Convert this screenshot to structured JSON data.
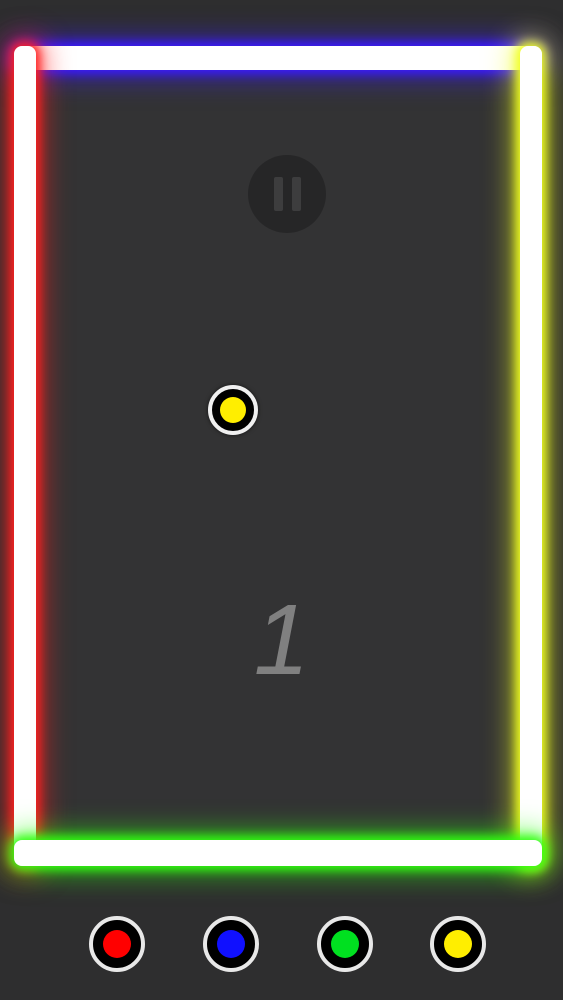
{
  "game": {
    "score": "1",
    "ball_color": "#ffee00"
  },
  "walls": {
    "top": {
      "color": "#3a1aff"
    },
    "left": {
      "color": "#ff2020"
    },
    "right": {
      "color": "#f0ff20"
    },
    "bottom": {
      "color": "#30ff10"
    },
    "corner_top_left": {
      "color": "#ff40ff"
    }
  },
  "controls": {
    "pause_icon": "pause-icon",
    "color_buttons": [
      {
        "name": "red",
        "color": "#ff0000"
      },
      {
        "name": "blue",
        "color": "#1010ff"
      },
      {
        "name": "green",
        "color": "#00e020"
      },
      {
        "name": "yellow",
        "color": "#ffee00"
      }
    ]
  }
}
